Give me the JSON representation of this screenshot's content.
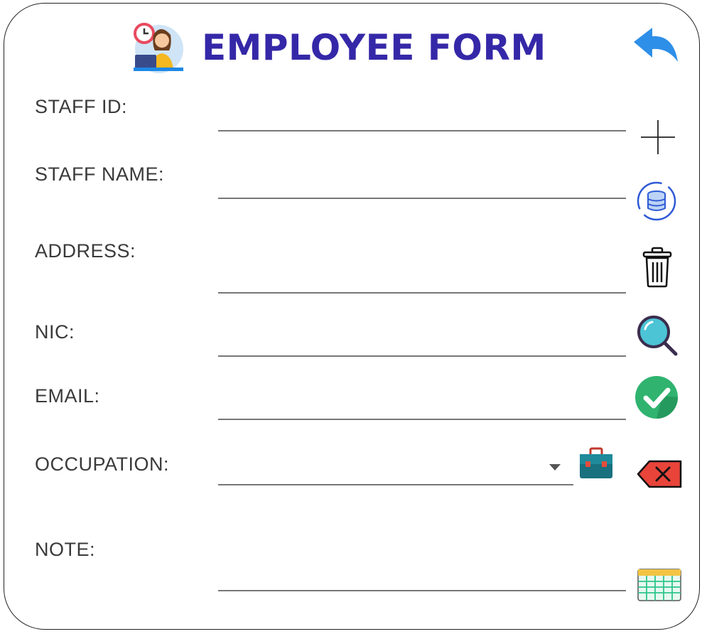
{
  "header": {
    "title": "EMPLOYEE FORM",
    "logo_icon": "employee-avatar-icon"
  },
  "form": {
    "fields": [
      {
        "key": "staff_id",
        "label": "STAFF ID:",
        "value": ""
      },
      {
        "key": "staff_name",
        "label": "STAFF NAME:",
        "value": ""
      },
      {
        "key": "address",
        "label": "ADDRESS:",
        "value": ""
      },
      {
        "key": "nic",
        "label": "NIC:",
        "value": ""
      },
      {
        "key": "email",
        "label": "EMAIL:",
        "value": ""
      },
      {
        "key": "occupation",
        "label": "OCCUPATION:",
        "value": ""
      },
      {
        "key": "note",
        "label": "NOTE:",
        "value": ""
      }
    ]
  },
  "toolbar": {
    "icons": [
      "back-arrow-icon",
      "add-icon",
      "database-refresh-icon",
      "trash-icon",
      "search-icon",
      "checkmark-icon",
      "clear-backspace-icon",
      "table-grid-icon"
    ],
    "occupation_icon": "briefcase-icon"
  },
  "colors": {
    "title": "#3528a8",
    "back_arrow": "#2e8fe8",
    "confirm_green": "#2fb36f",
    "clear_red": "#e8443a",
    "search_teal": "#4cc4d6"
  }
}
